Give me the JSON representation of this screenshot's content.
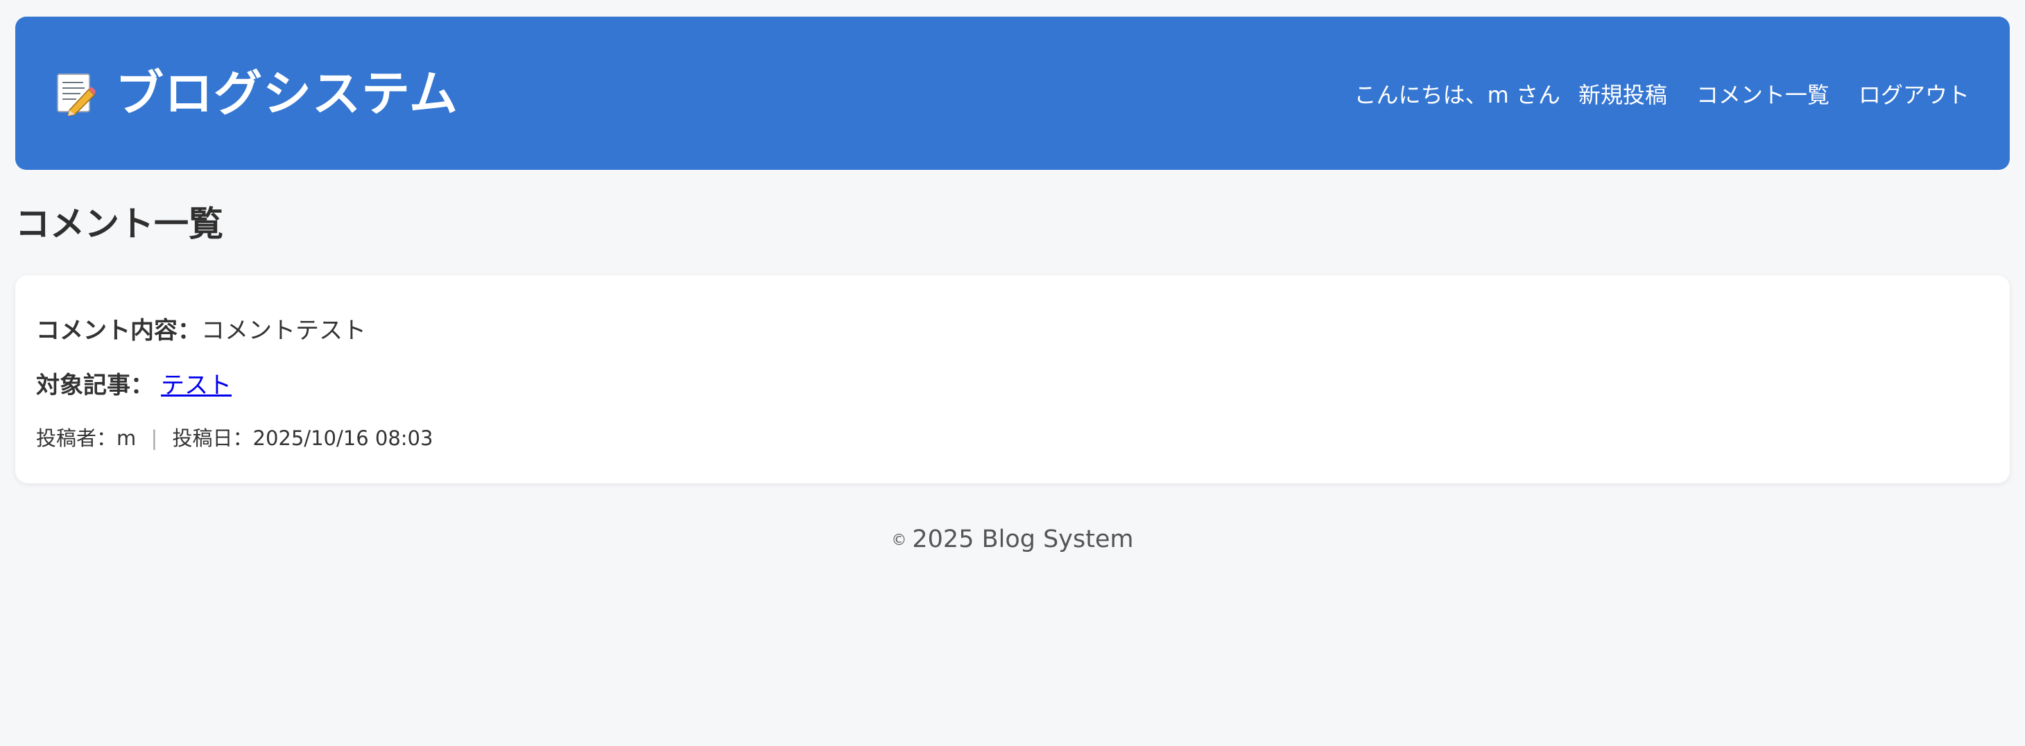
{
  "header": {
    "brand_icon": "memo-icon",
    "title": "ブログシステム",
    "greeting": "こんにちは、m さん",
    "nav": [
      {
        "label": "新規投稿"
      },
      {
        "label": "コメント一覧"
      },
      {
        "label": "ログアウト"
      }
    ],
    "accent_color": "#3476d1"
  },
  "main": {
    "page_title": "コメント一覧",
    "comments": [
      {
        "content_label": "コメント内容：",
        "content": "コメントテスト",
        "target_label": "対象記事：",
        "target_title": "テスト",
        "author_label": "投稿者：",
        "author": "m",
        "separator": "|",
        "date_label": "投稿日：",
        "date": "2025/10/16 08:03"
      }
    ]
  },
  "footer": {
    "copyright_symbol": "©",
    "text": "2025 Blog System"
  }
}
